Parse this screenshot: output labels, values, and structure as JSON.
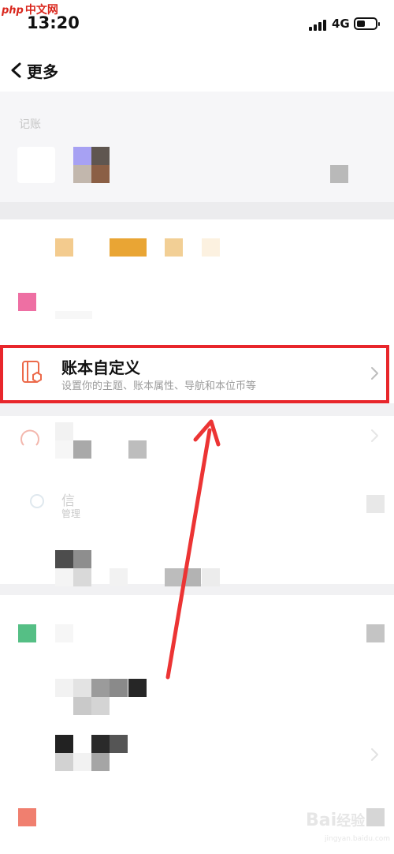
{
  "watermark_top": {
    "brand": "php",
    "label": "中文网"
  },
  "status_bar": {
    "time": "13:20",
    "network": "4G"
  },
  "nav": {
    "title": "更多"
  },
  "section1": {
    "label": "记账"
  },
  "highlight_row": {
    "title": "账本自定义",
    "subtitle": "设置你的主题、账本属性、导航和本位币等"
  },
  "faded_row": {
    "title": "信",
    "subtitle": "管理"
  },
  "watermark_bottom": {
    "logo": "Bai",
    "logo2": "经验",
    "url": "jingyan.baidu.com"
  },
  "colors": {
    "highlight_border": "#e8262b",
    "arrow": "#ec3434",
    "pink_icon": "#ee6fa3",
    "green_icon": "#55bf85",
    "salmon_icon": "#f07f6f"
  },
  "icons": [
    "back-icon",
    "notebook-customize-icon",
    "chevron-right-icon",
    "signal-icon",
    "battery-icon"
  ]
}
